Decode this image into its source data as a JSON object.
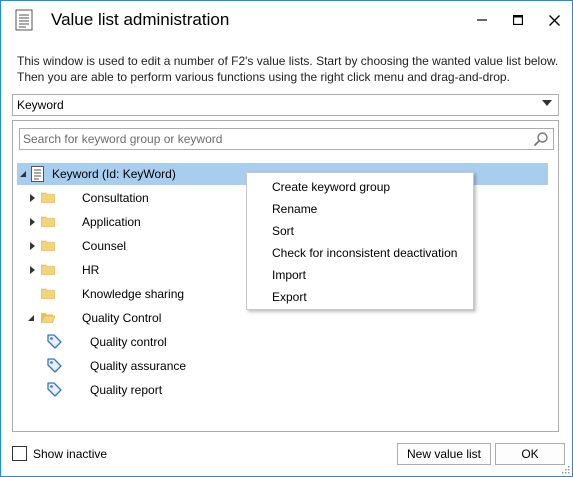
{
  "window": {
    "title": "Value list administration",
    "minimize_glyph": "–",
    "maximize_glyph": "□",
    "close_glyph": "✕"
  },
  "description": {
    "line1": "This window is used to edit a number of F2's value lists. Start by choosing the wanted value list below.",
    "line2": "Then you are able to perform various functions using the right click menu and drag-and-drop."
  },
  "value_list_select": {
    "selected": "Keyword"
  },
  "search": {
    "placeholder": "Search for keyword group or keyword"
  },
  "tree": {
    "root": {
      "label": "Keyword (Id: KeyWord)",
      "expanded": true,
      "selected": true
    },
    "groups": [
      {
        "label": "Consultation",
        "expander": "collapsed"
      },
      {
        "label": "Application",
        "expander": "collapsed"
      },
      {
        "label": "Counsel",
        "expander": "collapsed"
      },
      {
        "label": "HR",
        "expander": "collapsed"
      },
      {
        "label": "Knowledge sharing",
        "expander": "none"
      },
      {
        "label": "Quality Control",
        "expander": "expanded"
      }
    ],
    "keywords": [
      {
        "label": "Quality control"
      },
      {
        "label": "Quality assurance"
      },
      {
        "label": "Quality report"
      }
    ]
  },
  "context_menu": {
    "items": [
      "Create keyword group",
      "Rename",
      "Sort",
      "Check for inconsistent deactivation",
      "Import",
      "Export"
    ]
  },
  "footer": {
    "show_inactive_label": "Show inactive",
    "show_inactive_checked": false,
    "new_value_list_label": "New value list",
    "ok_label": "OK"
  },
  "colors": {
    "window_border": "#1a8fe0",
    "selection": "#a8cdef",
    "folder": "#f3d37c",
    "tag_icon": "#3a76c4"
  }
}
